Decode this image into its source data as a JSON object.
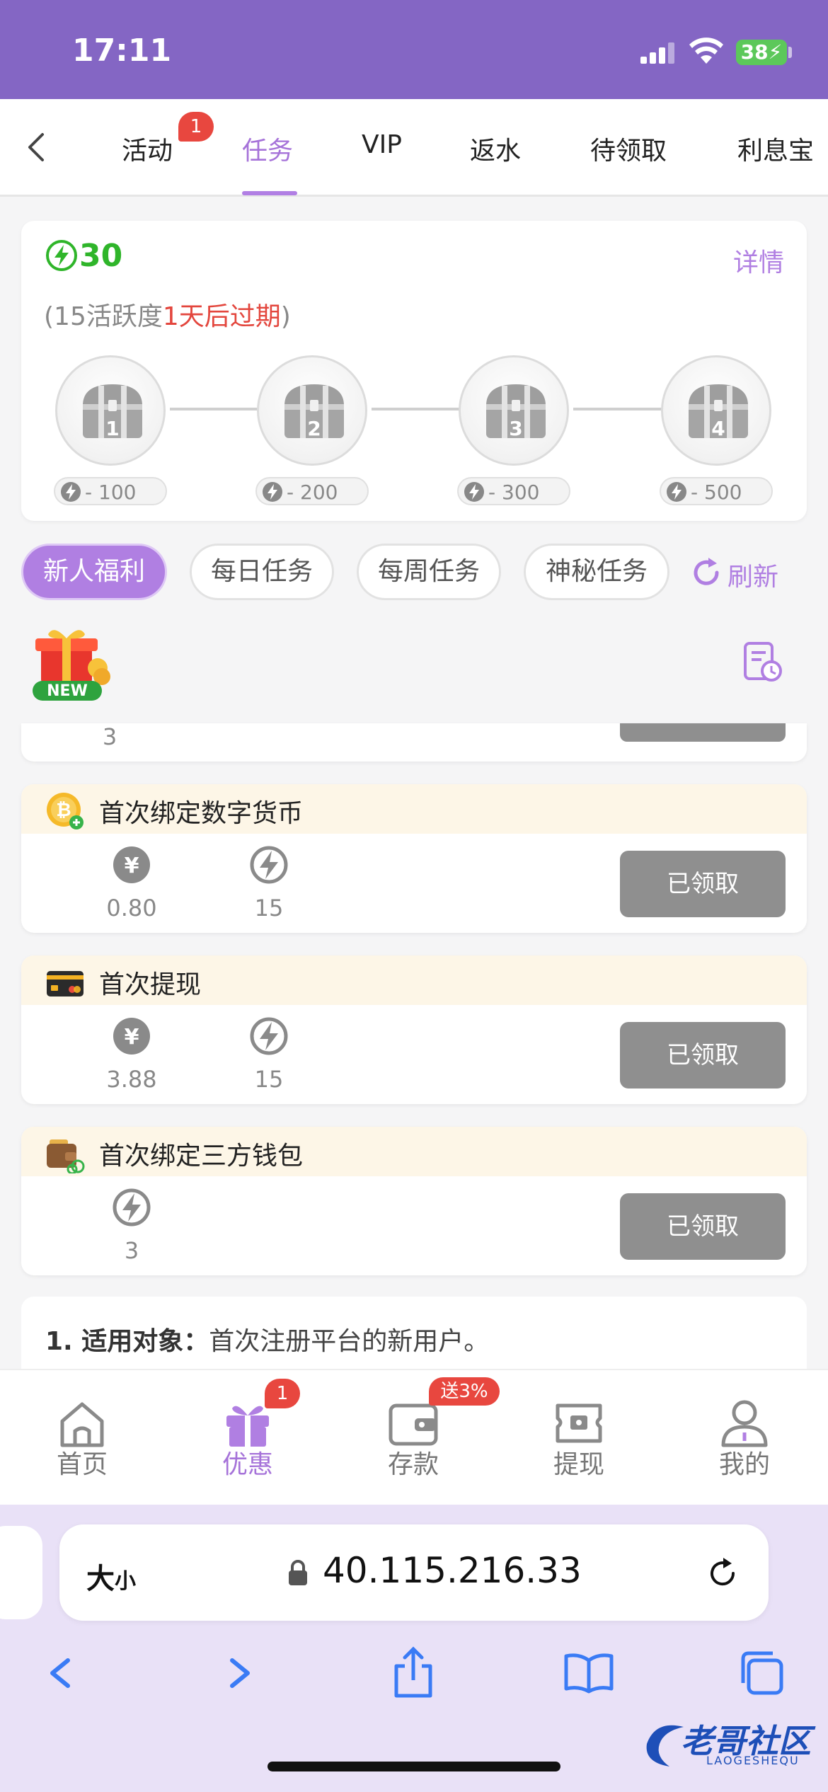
{
  "status_bar": {
    "time": "17:11",
    "battery": "38"
  },
  "tabs": [
    {
      "label": "活动"
    },
    {
      "label": "任务"
    },
    {
      "label": "VIP"
    },
    {
      "label": "返水"
    },
    {
      "label": "待领取"
    },
    {
      "label": "利息宝"
    }
  ],
  "tab_badge": "1",
  "activity": {
    "score": "30",
    "details_label": "详情",
    "expire_prefix": "(15活跃度",
    "expire_highlight": "1天后过期",
    "expire_suffix": ")",
    "chests": [
      {
        "num": "1",
        "cost": "- 100"
      },
      {
        "num": "2",
        "cost": "- 200"
      },
      {
        "num": "3",
        "cost": "- 300"
      },
      {
        "num": "4",
        "cost": "- 500"
      }
    ]
  },
  "categories": [
    {
      "label": "新人福利"
    },
    {
      "label": "每日任务"
    },
    {
      "label": "每周任务"
    },
    {
      "label": "神秘任务"
    }
  ],
  "refresh_label": "刷新",
  "new_badge": "NEW",
  "partial_task": {
    "value": "3"
  },
  "tasks": [
    {
      "title": "首次绑定数字货币",
      "money": "0.80",
      "points": "15",
      "button": "已领取"
    },
    {
      "title": "首次提现",
      "money": "3.88",
      "points": "15",
      "button": "已领取"
    },
    {
      "title": "首次绑定三方钱包",
      "points": "3",
      "button": "已领取"
    }
  ],
  "currency_symbol": "¥",
  "rules": {
    "label": "1. 适用对象：",
    "text": "首次注册平台的新用户。"
  },
  "bottom_nav": [
    {
      "label": "首页"
    },
    {
      "label": "优惠"
    },
    {
      "label": "存款"
    },
    {
      "label": "提现"
    },
    {
      "label": "我的"
    }
  ],
  "nav_badge": "1",
  "deposit_badge": "送3%",
  "browser": {
    "aa": "大",
    "aa_small": "小",
    "url": "40.115.216.33"
  },
  "watermark": {
    "text": "老哥社区",
    "sub": "LAOGESHEQU"
  },
  "colors": {
    "accent": "#b07fe2",
    "header": "#8466c4",
    "green": "#2fb52a",
    "red": "#e3463d",
    "claimed": "#8f8f8f"
  }
}
